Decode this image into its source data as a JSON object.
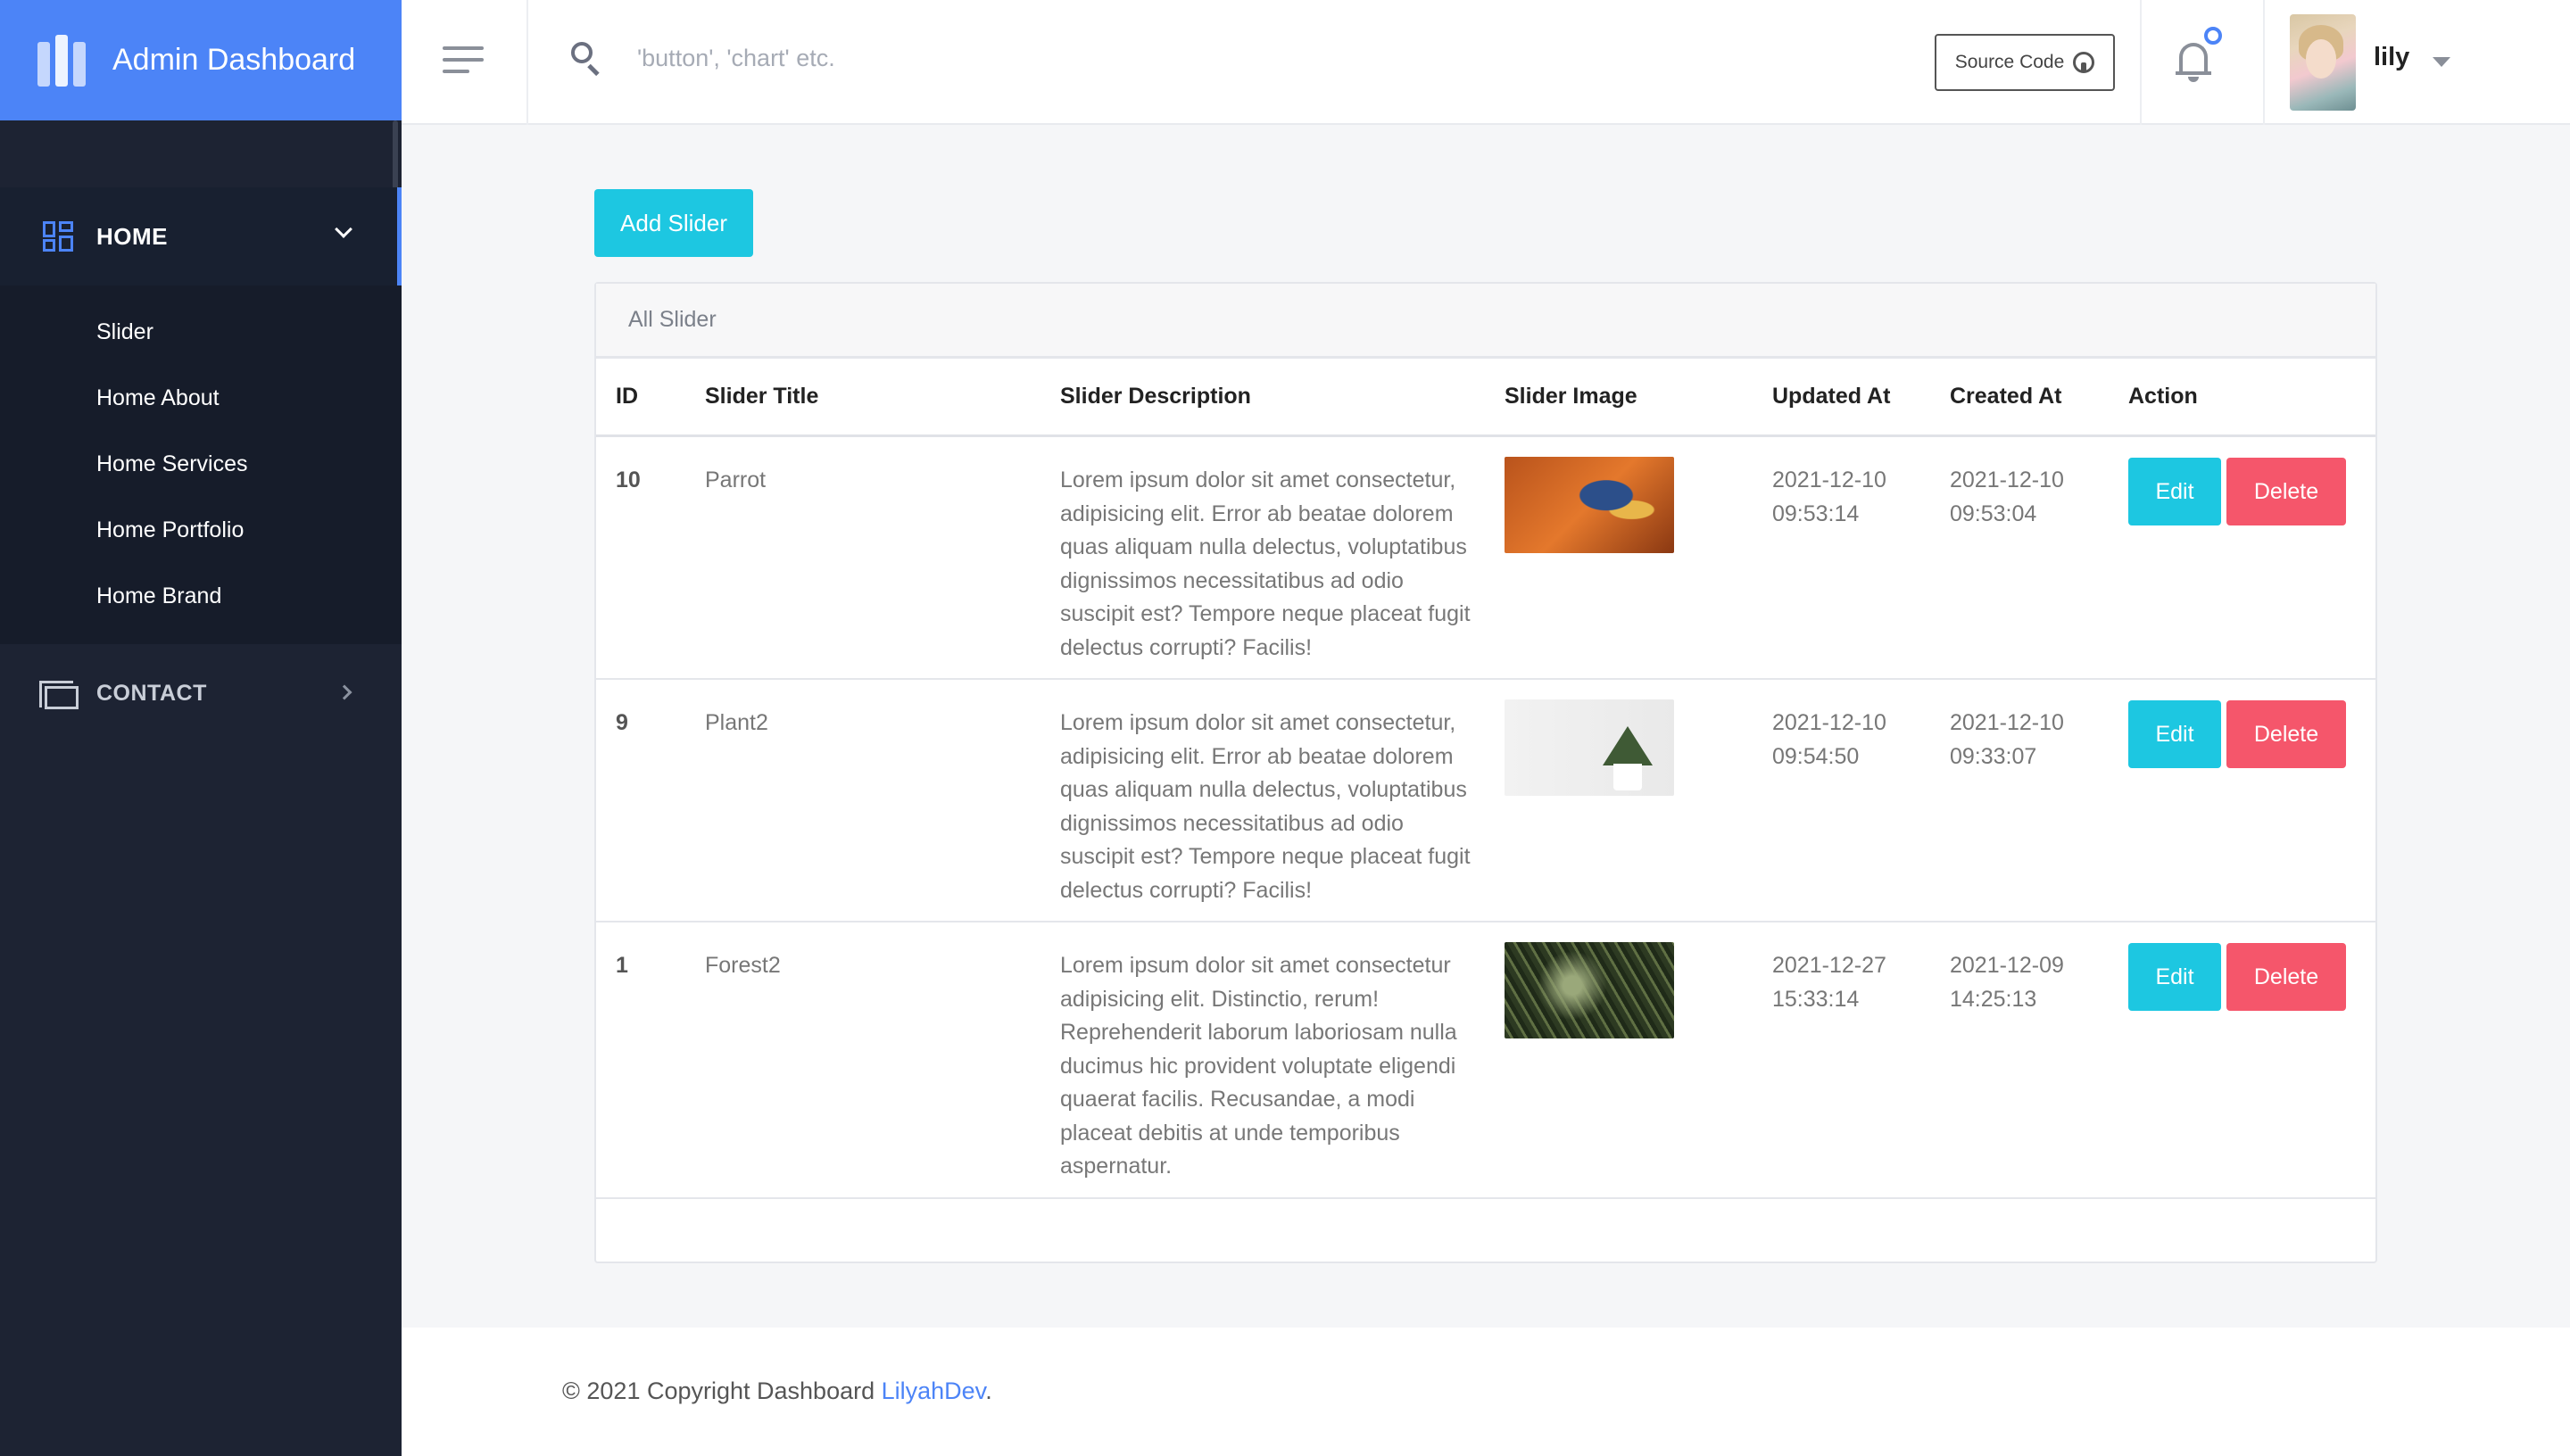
{
  "app": {
    "title": "Admin Dashboard"
  },
  "sidebar": {
    "home_label": "HOME",
    "items": [
      {
        "label": "Slider"
      },
      {
        "label": "Home About"
      },
      {
        "label": "Home Services"
      },
      {
        "label": "Home Portfolio"
      },
      {
        "label": "Home Brand"
      }
    ],
    "contact_label": "CONTACT"
  },
  "topbar": {
    "search_placeholder": "'button', 'chart' etc.",
    "source_code_label": "Source Code",
    "username": "lily"
  },
  "main": {
    "add_button_label": "Add Slider",
    "card_title": "All Slider",
    "columns": [
      "ID",
      "Slider Title",
      "Slider Description",
      "Slider Image",
      "Updated At",
      "Created At",
      "Action"
    ],
    "rows": [
      {
        "id": "10",
        "title": "Parrot",
        "description": "Lorem ipsum dolor sit amet consectetur, adipisicing elit. Error ab beatae dolorem quas aliquam nulla delectus, voluptatibus dignissimos necessitatibus ad odio suscipit est? Tempore neque placeat fugit delectus corrupti? Facilis!",
        "image": "parrot",
        "updated_date": "2021-12-10",
        "updated_time": "09:53:14",
        "created_date": "2021-12-10",
        "created_time": "09:53:04"
      },
      {
        "id": "9",
        "title": "Plant2",
        "description": "Lorem ipsum dolor sit amet consectetur, adipisicing elit. Error ab beatae dolorem quas aliquam nulla delectus, voluptatibus dignissimos necessitatibus ad odio suscipit est? Tempore neque placeat fugit delectus corrupti? Facilis!",
        "image": "plant",
        "updated_date": "2021-12-10",
        "updated_time": "09:54:50",
        "created_date": "2021-12-10",
        "created_time": "09:33:07"
      },
      {
        "id": "1",
        "title": "Forest2",
        "description": "Lorem ipsum dolor sit amet consectetur adipisicing elit. Distinctio, rerum! Reprehenderit laborum laboriosam nulla ducimus hic provident voluptate eligendi quaerat facilis. Recusandae, a modi placeat debitis at unde temporibus aspernatur.",
        "image": "forest",
        "updated_date": "2021-12-27",
        "updated_time": "15:33:14",
        "created_date": "2021-12-09",
        "created_time": "14:25:13"
      }
    ],
    "edit_label": "Edit",
    "delete_label": "Delete"
  },
  "footer": {
    "text": "© 2021 Copyright Dashboard",
    "link": "LilyahDev",
    "suffix": "."
  },
  "colors": {
    "brand": "#4c84f7",
    "sidebar": "#1d2333",
    "edit": "#1dc7e1",
    "delete": "#f5566b"
  }
}
